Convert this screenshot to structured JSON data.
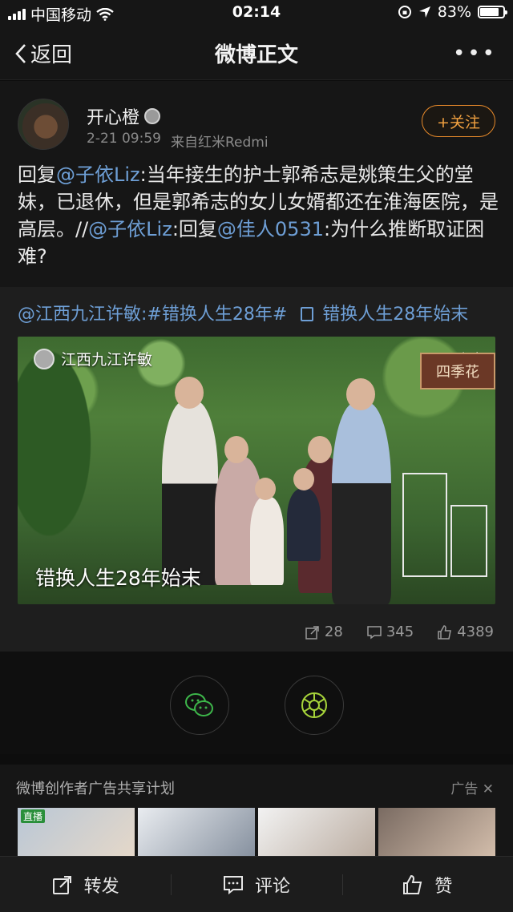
{
  "status_bar": {
    "carrier": "中国移动",
    "time": "02:14",
    "battery": "83%",
    "battery_level": 0.83
  },
  "nav": {
    "back_label": "返回",
    "title": "微博正文",
    "more": "•••"
  },
  "post": {
    "author": "开心橙",
    "time": "2-21 09:59",
    "source": "来自红米Redmi",
    "follow_label": "+关注",
    "text": [
      {
        "t": "回复",
        "m": false
      },
      {
        "t": "@子依Liz",
        "m": true
      },
      {
        "t": ":当年接生的护士郭希志是姚策生父的堂妹，已退休，但是郭希志的女儿女婿都还在淮海医院，是高层。//",
        "m": false
      },
      {
        "t": "@子依Liz",
        "m": true
      },
      {
        "t": ":回复",
        "m": false
      },
      {
        "t": "@佳人0531",
        "m": true
      },
      {
        "t": ":为什么推断取证困难?",
        "m": false
      }
    ]
  },
  "repost": {
    "head_prefix": "@江西九江许敏:#错换人生28年#",
    "article_link": "错换人生28年始末",
    "cover": {
      "source_name": "江西九江许敏",
      "badge": "文章",
      "sign": "四季花",
      "caption": "错换人生28年始末"
    },
    "stats": {
      "reposts": "28",
      "comments": "345",
      "likes": "4389"
    }
  },
  "ad": {
    "title": "微博创作者广告共享计划",
    "label": "广告",
    "live_badge": "直播"
  },
  "toolbar": {
    "repost": "转发",
    "comment": "评论",
    "like": "赞"
  },
  "colors": {
    "accent_orange": "#e88a2a",
    "mention_blue": "#6e9fd6",
    "bg": "#0d0d0d"
  }
}
